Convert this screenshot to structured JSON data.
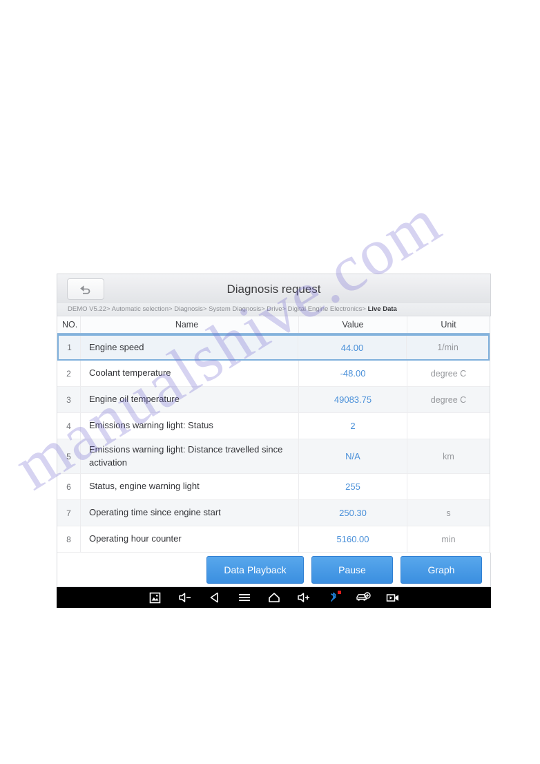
{
  "watermark": {
    "text": "manualshive.com"
  },
  "titlebar": {
    "title": "Diagnosis request",
    "back_icon": "back-arrow-icon"
  },
  "breadcrumb": {
    "path": "DEMO V5.22> Automatic selection> Diagnosis> System Diagnosis> Drive> Digital Engine Electronics> ",
    "current": "Live Data"
  },
  "table": {
    "columns": {
      "no": "NO.",
      "name": "Name",
      "value": "Value",
      "unit": "Unit"
    },
    "rows": [
      {
        "no": "1",
        "name": "Engine speed",
        "value": "44.00",
        "unit": "1/min"
      },
      {
        "no": "2",
        "name": "Coolant temperature",
        "value": "-48.00",
        "unit": "degree C"
      },
      {
        "no": "3",
        "name": "Engine oil temperature",
        "value": "49083.75",
        "unit": "degree C"
      },
      {
        "no": "4",
        "name": "Emissions warning light: Status",
        "value": "2",
        "unit": ""
      },
      {
        "no": "5",
        "name": "Emissions warning light: Distance travelled since activation",
        "value": "N/A",
        "unit": "km"
      },
      {
        "no": "6",
        "name": "Status, engine warning light",
        "value": "255",
        "unit": ""
      },
      {
        "no": "7",
        "name": "Operating time since engine start",
        "value": "250.30",
        "unit": "s"
      },
      {
        "no": "8",
        "name": "Operating hour counter",
        "value": "5160.00",
        "unit": "min"
      }
    ]
  },
  "actions": {
    "data_playback": "Data Playback",
    "pause": "Pause",
    "graph": "Graph"
  },
  "navbar": {
    "items": [
      {
        "icon": "screenshot-icon"
      },
      {
        "icon": "volume-down-icon"
      },
      {
        "icon": "back-triangle-icon"
      },
      {
        "icon": "menu-icon"
      },
      {
        "icon": "home-icon"
      },
      {
        "icon": "volume-up-icon"
      },
      {
        "icon": "bluetooth-icon"
      },
      {
        "icon": "vehicle-add-icon"
      },
      {
        "icon": "video-record-icon"
      }
    ]
  },
  "colors": {
    "accent_blue": "#4a90d9",
    "button_blue": "#3b8fe0",
    "selected_border": "#7fb0dc",
    "navbar_bg": "#000000",
    "bluetooth_blue": "#1f7fd4",
    "badge_red": "#e01b1b"
  }
}
